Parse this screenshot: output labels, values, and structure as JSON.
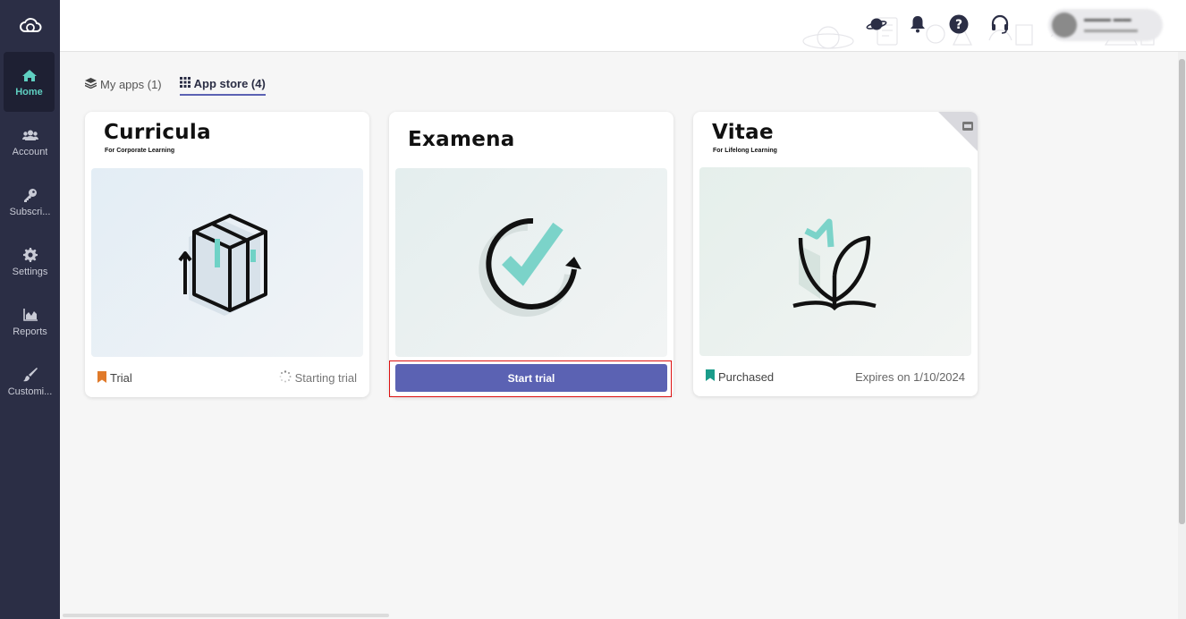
{
  "sidebar": {
    "logo_icon": "cloud-logo-icon",
    "items": [
      {
        "label": "Home",
        "icon": "home-icon",
        "active": true
      },
      {
        "label": "Account",
        "icon": "users-icon"
      },
      {
        "label": "Subscri...",
        "icon": "key-icon"
      },
      {
        "label": "Settings",
        "icon": "gear-icon"
      },
      {
        "label": "Reports",
        "icon": "area-chart-icon"
      },
      {
        "label": "Customi...",
        "icon": "paintbrush-icon"
      }
    ]
  },
  "header": {
    "icons": [
      "planet-icon",
      "bell-icon",
      "help-icon",
      "headset-icon"
    ]
  },
  "tabs": [
    {
      "label": "My apps (1)",
      "icon": "layers-icon",
      "active": false
    },
    {
      "label": "App store (4)",
      "icon": "grid-icon",
      "active": true
    }
  ],
  "cards": [
    {
      "title": "Curricula",
      "subtitle": "For Corporate Learning",
      "status": "Trial",
      "action": "Starting trial"
    },
    {
      "title": "Examena",
      "subtitle": "",
      "button": "Start trial"
    },
    {
      "title": "Vitae",
      "subtitle": "For Lifelong Learning",
      "status": "Purchased",
      "expiry": "Expires on 1/10/2024"
    }
  ],
  "colors": {
    "sidebar": "#2b2e45",
    "accent": "#5b62b3",
    "teal": "#5fcfc1",
    "trial": "#e07a2a",
    "purchased": "#1a9c8a"
  }
}
